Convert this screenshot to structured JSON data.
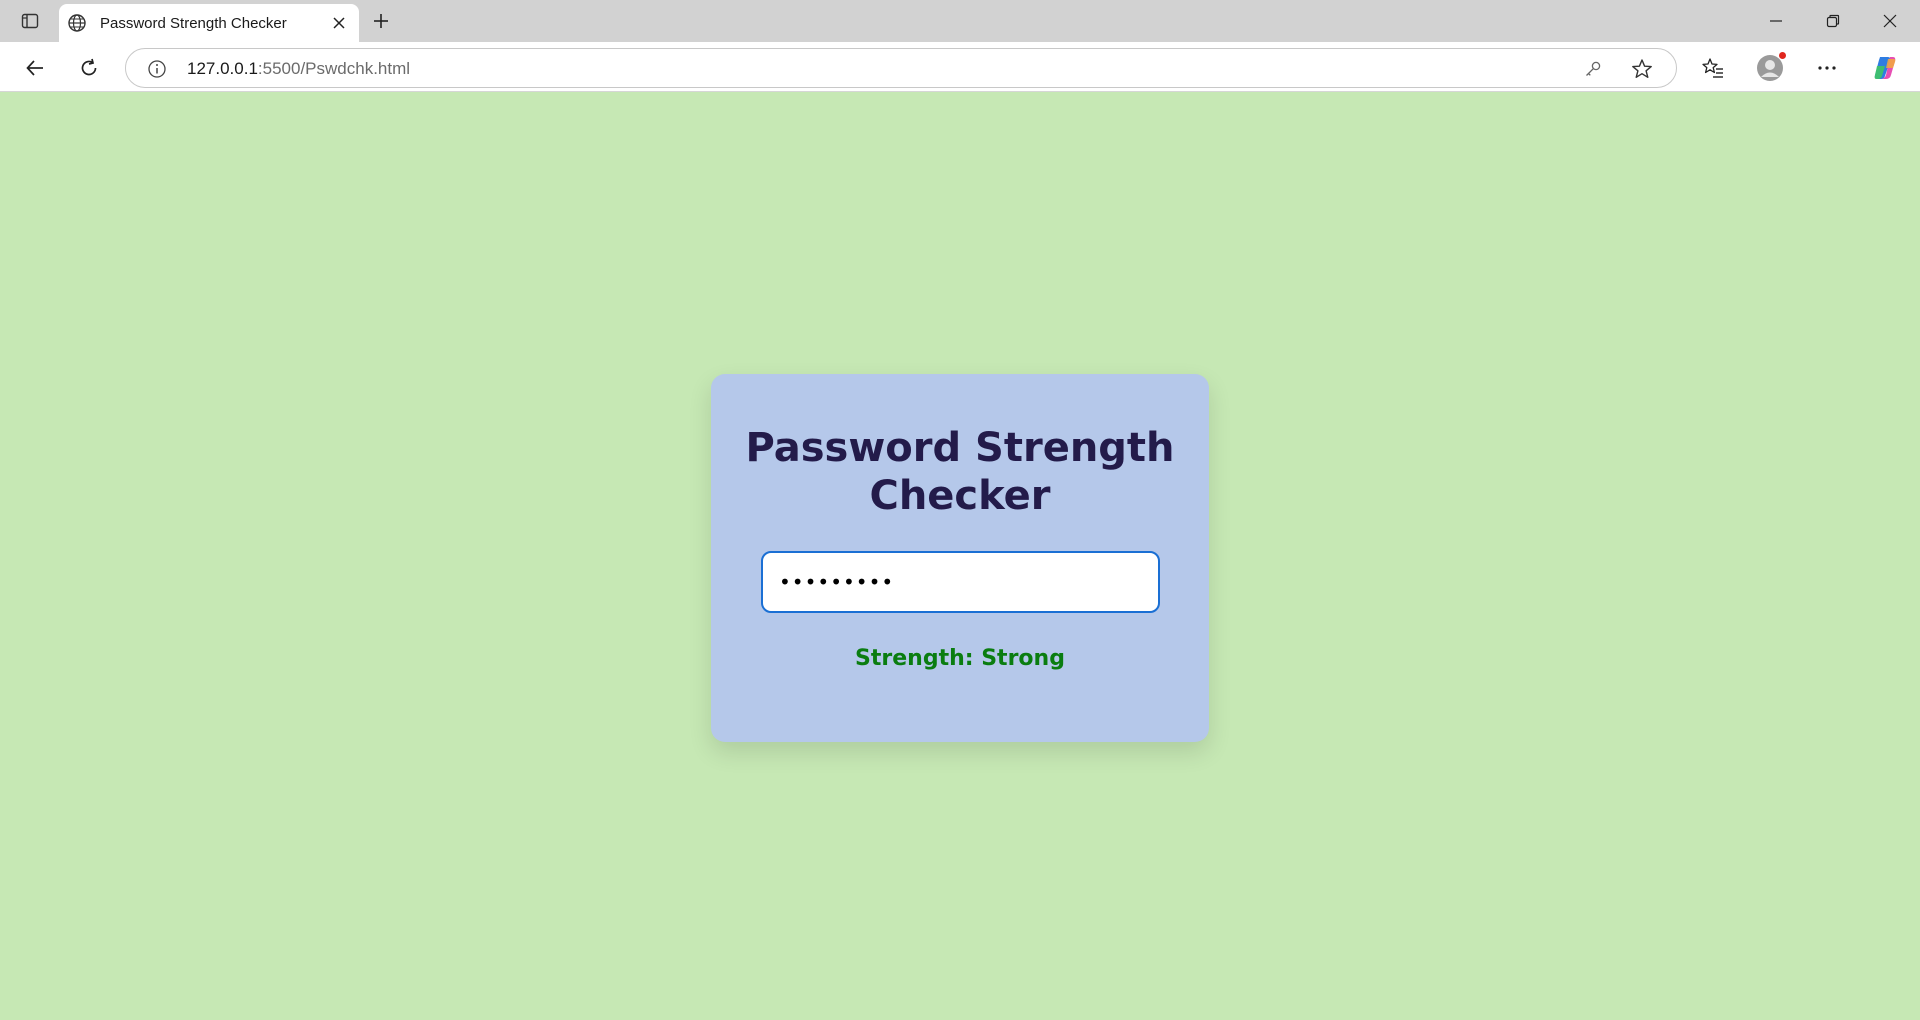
{
  "browser": {
    "tab": {
      "title": "Password Strength Checker",
      "favicon": "globe-icon"
    },
    "address": {
      "host": "127.0.0.1",
      "rest": ":5500/Pswdchk.html"
    }
  },
  "page": {
    "title": "Password Strength Checker",
    "password_value": "secret123",
    "strength_text": "Strength: Strong"
  },
  "colors": {
    "page_background": "#c6e8b4",
    "card_background": "#b5c8ea",
    "title": "#231b4a",
    "strength_strong": "#0a7d10",
    "input_focus_border": "#1a6fd4"
  }
}
